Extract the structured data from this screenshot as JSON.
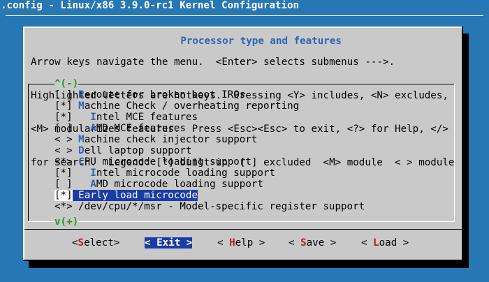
{
  "window": {
    "title": ".config - Linux/x86 3.9.0-rc1 Kernel Configuration"
  },
  "dialog": {
    "title": "Processor type and features",
    "help_lines": [
      "Arrow keys navigate the menu.  <Enter> selects submenus --->.",
      "Highlighted letters are hotkeys.  Pressing <Y> includes, <N> excludes,",
      "<M> modularizes features.  Press <Esc><Esc> to exit, <?> for Help, </>",
      "for Search.  Legend: [*] built-in  [ ] excluded  <M> module  < > module"
    ]
  },
  "menu": {
    "scroll_up": "^(-)",
    "scroll_down": "v(+)",
    "items": [
      {
        "mark": "[ ]",
        "indent": "",
        "hotkey": "R",
        "rest": "eroute for broken boot IRQs"
      },
      {
        "mark": "[*]",
        "indent": "",
        "hotkey": "M",
        "rest": "achine Check / overheating reporting"
      },
      {
        "mark": "[*]",
        "indent": "  ",
        "hotkey": "I",
        "rest": "ntel MCE features"
      },
      {
        "mark": "[ ]",
        "indent": "  ",
        "hotkey": "A",
        "rest": "MD MCE features"
      },
      {
        "mark": "< >",
        "indent": "",
        "hotkey": "M",
        "rest": "achine check injector support"
      },
      {
        "mark": "< >",
        "indent": "",
        "hotkey": "D",
        "rest": "ell laptop support"
      },
      {
        "mark": "<*>",
        "indent": "",
        "hotkey": "C",
        "rest": "PU microcode loading support"
      },
      {
        "mark": "[*]",
        "indent": "  ",
        "hotkey": "I",
        "rest": "ntel microcode loading support"
      },
      {
        "mark": "[ ]",
        "indent": "  ",
        "hotkey": "A",
        "rest": "MD microcode loading support"
      },
      {
        "mark": "[*]",
        "indent": "",
        "hotkey": "E",
        "rest": "arly load microcode",
        "selected": true
      },
      {
        "mark": "<*>",
        "indent": "",
        "hotkey": "",
        "rest": "/dev/cpu/*/msr - Model-specific register support"
      }
    ]
  },
  "buttons": {
    "select": {
      "first": "S",
      "rest": "elect"
    },
    "exit": {
      "first": "E",
      "rest": "xit"
    },
    "help": {
      "first": "H",
      "rest": "elp"
    },
    "save": {
      "first": "S",
      "rest": "ave"
    },
    "load": {
      "first": "L",
      "rest": "oad"
    }
  },
  "colors": {
    "background": "#2777b5",
    "dialog": "#c9c9c9",
    "highlight": "#1b3ca6",
    "hotkey": "#2f63b6",
    "button_hotkey": "#b51f1f",
    "scroll_indicator": "#1d9c1d"
  }
}
